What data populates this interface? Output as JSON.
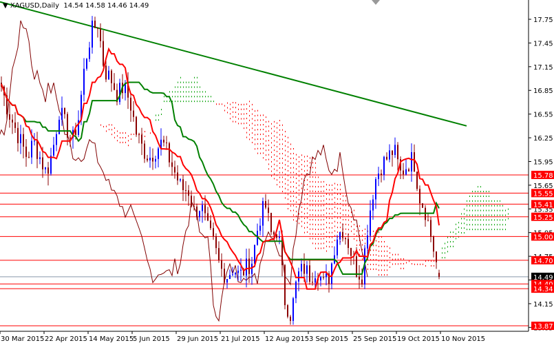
{
  "header": {
    "symbol_label": "XAGUSD,Daily",
    "ohlc": "14.54 14.58 14.46 14.49"
  },
  "chart_data": {
    "type": "candlestick",
    "title": "XAGUSD,Daily",
    "ylim": [
      13.83,
      17.97
    ],
    "y_ticks": [
      "17.75",
      "17.45",
      "17.15",
      "16.85",
      "16.55",
      "16.25",
      "15.95",
      "15.65",
      "15.35",
      "15.05",
      "14.75",
      "14.45",
      "14.15",
      "13.85"
    ],
    "x_tick_labels": [
      "30 Mar 2015",
      "22 Apr 2015",
      "14 May 2015",
      "5 Jun 2015",
      "29 Jun 2015",
      "21 Jul 2015",
      "12 Aug 2015",
      "3 Sep 2015",
      "25 Sep 2015",
      "19 Oct 2015",
      "10 Nov 2015"
    ],
    "closes_approx": [
      16.9,
      16.6,
      16.4,
      16.2,
      16.0,
      16.2,
      16.0,
      15.8,
      16.1,
      16.6,
      16.4,
      16.2,
      16.5,
      17.2,
      17.6,
      17.7,
      17.1,
      17.0,
      16.8,
      16.9,
      16.7,
      16.3,
      16.1,
      16.0,
      16.1,
      16.2,
      16.0,
      15.8,
      15.6,
      15.6,
      15.3,
      15.4,
      15.1,
      14.9,
      14.6,
      14.5,
      14.6,
      14.5,
      14.6,
      14.7,
      15.2,
      15.4,
      15.0,
      15.1,
      14.2,
      14.0,
      14.5,
      14.6,
      14.5,
      14.6,
      14.4,
      14.5,
      15.0,
      15.1,
      14.9,
      14.6,
      14.5,
      15.2,
      15.7,
      15.9,
      16.0,
      16.1,
      15.8,
      15.9,
      16.0,
      15.5,
      15.3,
      14.9,
      14.49
    ],
    "trendline": {
      "from": 17.97,
      "to": 16.4
    },
    "levels": [
      {
        "value": "15.78",
        "color": "#ff0000"
      },
      {
        "value": "15.55",
        "color": "#ff0000"
      },
      {
        "value": "15.41",
        "color": "#ff0000"
      },
      {
        "value": "15.25",
        "color": "#ff0000"
      },
      {
        "value": "15.00",
        "color": "#ff0000"
      },
      {
        "value": "14.70",
        "color": "#ff0000"
      },
      {
        "value": "14.49",
        "color": "#000000"
      },
      {
        "value": "14.40",
        "color": "#ff0000"
      },
      {
        "value": "14.34",
        "color": "#ff0000"
      },
      {
        "value": "13.87",
        "color": "#ff0000"
      }
    ],
    "colors": {
      "bull": "#0000ff",
      "bear": "#8b0000",
      "tenkan": "#ff0000",
      "kijun": "#008000",
      "chikou": "#800000",
      "trend": "#008000"
    }
  }
}
